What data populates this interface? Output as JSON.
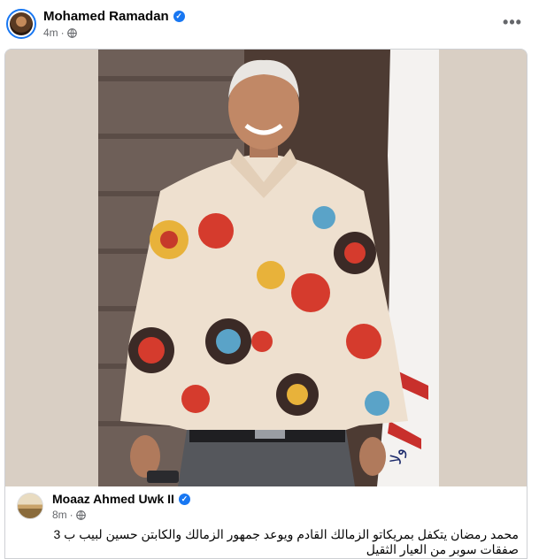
{
  "post": {
    "author": "Mohamed Ramadan",
    "time": "4m",
    "separator": "·",
    "more_label": "•••"
  },
  "shared": {
    "author": "Moaaz Ahmed Uwk II",
    "time": "8m",
    "separator": "·",
    "text": "محمد رمضان يتكفل بمريكاتو الزمالك القادم ويوعد جمهور الزمالك والكابتن حسين لبيب ب 3 صفقات سوبر من العيار الثقيل"
  },
  "icons": {
    "verified": "verified-badge-icon",
    "privacy": "globe-icon",
    "more": "more-options-icon"
  },
  "colors": {
    "verified": "#1877f2",
    "meta_text": "#65676b",
    "card_bg": "#ffffff",
    "photo_bg": "#d9cfc4"
  }
}
